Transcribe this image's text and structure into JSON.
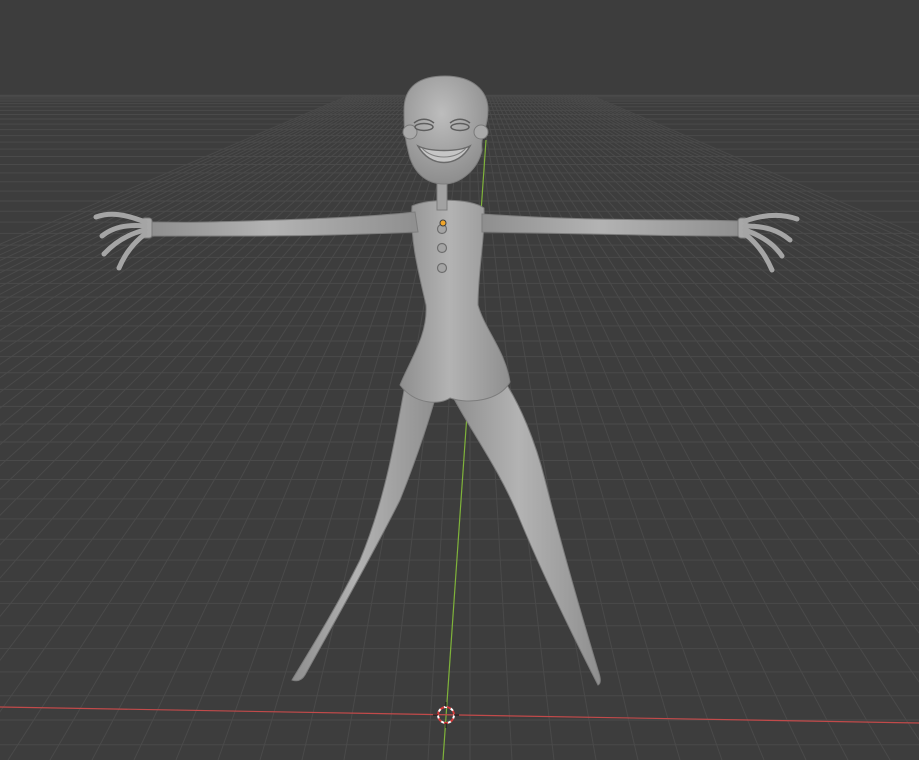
{
  "viewport": {
    "background": "#3d3d3d",
    "grid_color": "#4a4a4a",
    "x_axis_color": "#c24a4a",
    "y_axis_color": "#7fb33a"
  },
  "scene": {
    "model": {
      "body_color": "#9e9e9e",
      "shadow_color": "#7a7a7a",
      "origin_color": "#f0a52a"
    },
    "cursor_icon": "3d-cursor-icon"
  }
}
